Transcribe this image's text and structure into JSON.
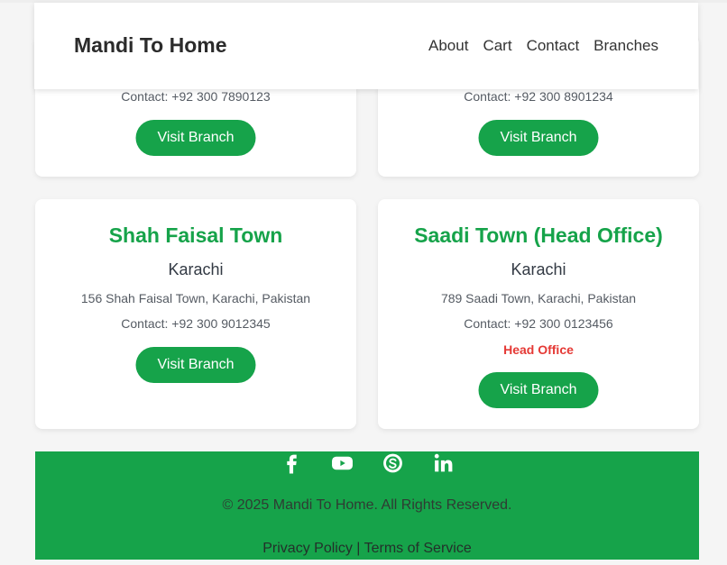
{
  "header": {
    "brand": "Mandi To Home",
    "nav": [
      "About",
      "Cart",
      "Contact",
      "Branches"
    ]
  },
  "branches_top": [
    {
      "contact": "Contact: +92 300 7890123",
      "button": "Visit Branch"
    },
    {
      "contact": "Contact: +92 300 8901234",
      "button": "Visit Branch"
    }
  ],
  "branches": [
    {
      "name": "Shah Faisal Town",
      "city": "Karachi",
      "address": "156 Shah Faisal Town, Karachi, Pakistan",
      "contact": "Contact: +92 300 9012345",
      "button": "Visit Branch"
    },
    {
      "name": "Saadi Town (Head Office)",
      "city": "Karachi",
      "address": "789 Saadi Town, Karachi, Pakistan",
      "contact": "Contact: +92 300 0123456",
      "tag": "Head Office",
      "button": "Visit Branch"
    }
  ],
  "footer": {
    "socials": [
      "facebook-icon",
      "youtube-icon",
      "skype-icon",
      "linkedin-icon"
    ],
    "copyright": "© 2025 Mandi To Home. All Rights Reserved.",
    "privacy": "Privacy Policy",
    "separator": "|",
    "terms": "Terms of Service"
  },
  "colors": {
    "brand_green": "#16a34a",
    "head_office_red": "#e53935"
  }
}
